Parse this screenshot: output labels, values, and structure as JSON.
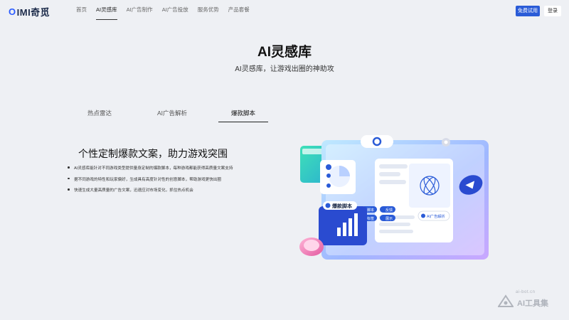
{
  "brand": {
    "logo_text": "IMI奇觅",
    "logo_mark": "O"
  },
  "nav": {
    "links": [
      "首页",
      "AI灵感库",
      "AI广告制作",
      "AI广告投放",
      "服务优势",
      "产品套餐"
    ],
    "active_index": 1,
    "trial_label": "免费试用",
    "login_label": "登录"
  },
  "hero": {
    "title": "AI灵感库",
    "subtitle": "AI灵感库，让游戏出圈的神助攻"
  },
  "tabs": [
    "热点雷达",
    "AI广告解析",
    "爆款脚本"
  ],
  "active_tab": 2,
  "feature": {
    "title": "个性定制爆款文案，助力游戏突围",
    "bullets": [
      "AI灵感库能针对不同游戏类型提供量身定制的爆款脚本，每种游戏都能获得高质量文案支持",
      "据不同游戏的特性和玩家偏好，生成具有高度针对性的创意脚本，帮助游戏更快出圈",
      "快速生成大量高质量的广告文案，迅速应对市场变化，抓住热点机会"
    ]
  },
  "illustration": {
    "script_badge": "爆款脚本",
    "analysis_badge": "AI广告解析",
    "chips": [
      "脚本",
      "反馈",
      "标签",
      "展示"
    ],
    "accent": "#2a5bd7"
  },
  "watermark": {
    "url": "ai-bot.cn",
    "text": "AI工具集"
  }
}
